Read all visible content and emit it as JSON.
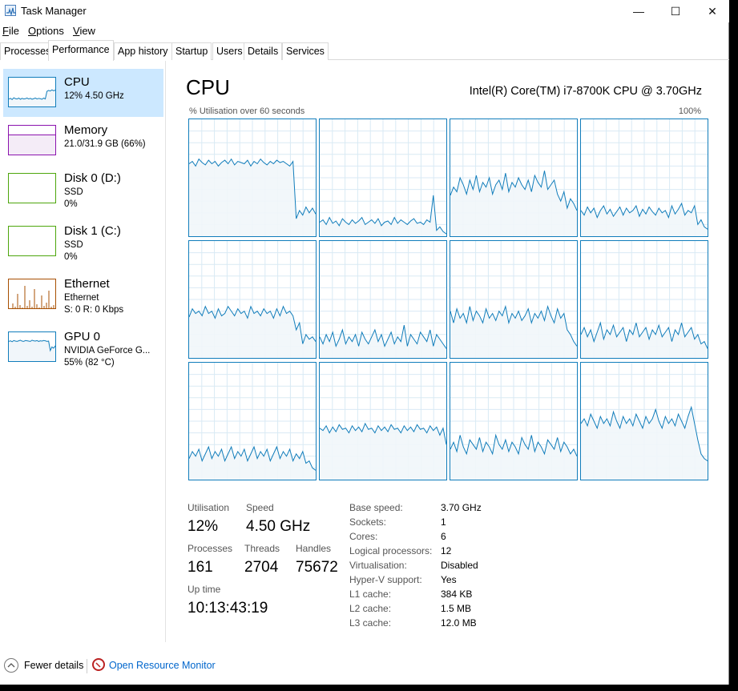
{
  "window": {
    "title": "Task Manager",
    "controls": {
      "minimize": "—",
      "maximize": "☐",
      "close": "✕"
    }
  },
  "menu": [
    {
      "label": "File",
      "accel": "F",
      "rest": "ile"
    },
    {
      "label": "Options",
      "accel": "O",
      "rest": "ptions"
    },
    {
      "label": "View",
      "accel": "V",
      "rest": "iew"
    }
  ],
  "tabs": [
    "Processes",
    "Performance",
    "App history",
    "Startup",
    "Users",
    "Details",
    "Services"
  ],
  "active_tab": "Performance",
  "sidebar": [
    {
      "title": "CPU",
      "lines": [
        "12%  4.50 GHz"
      ],
      "color": "#117dbb",
      "selected": true
    },
    {
      "title": "Memory",
      "lines": [
        "21.0/31.9 GB (66%)"
      ],
      "color": "#8b12ae",
      "selected": false
    },
    {
      "title": "Disk 0 (D:)",
      "lines": [
        "SSD",
        "0%"
      ],
      "color": "#4da60c",
      "selected": false
    },
    {
      "title": "Disk 1 (C:)",
      "lines": [
        "SSD",
        "0%"
      ],
      "color": "#4da60c",
      "selected": false
    },
    {
      "title": "Ethernet",
      "lines": [
        "Ethernet",
        "S: 0  R: 0 Kbps"
      ],
      "color": "#a74f01",
      "selected": false
    },
    {
      "title": "GPU 0",
      "lines": [
        "NVIDIA GeForce G...",
        "55% (82 °C)"
      ],
      "color": "#117dbb",
      "selected": false
    }
  ],
  "main": {
    "title": "CPU",
    "cpu_name": "Intel(R) Core(TM) i7-8700K CPU @ 3.70GHz",
    "graph_label": "% Utilisation over 60 seconds",
    "graph_max": "100%",
    "accent": "#117dbb",
    "fill": "#f1f6fa",
    "grid_color": "#d9eaf4"
  },
  "stats": {
    "utilisation_label": "Utilisation",
    "utilisation": "12%",
    "speed_label": "Speed",
    "speed": "4.50 GHz",
    "processes_label": "Processes",
    "processes": "161",
    "threads_label": "Threads",
    "threads": "2704",
    "handles_label": "Handles",
    "handles": "75672",
    "uptime_label": "Up time",
    "uptime": "10:13:43:19"
  },
  "specs": [
    {
      "label": "Base speed:",
      "value": "3.70 GHz"
    },
    {
      "label": "Sockets:",
      "value": "1"
    },
    {
      "label": "Cores:",
      "value": "6"
    },
    {
      "label": "Logical processors:",
      "value": "12"
    },
    {
      "label": "Virtualisation:",
      "value": "Disabled"
    },
    {
      "label": "Hyper-V support:",
      "value": "Yes"
    },
    {
      "label": "L1 cache:",
      "value": "384 KB"
    },
    {
      "label": "L2 cache:",
      "value": "1.5 MB"
    },
    {
      "label": "L3 cache:",
      "value": "12.0 MB"
    }
  ],
  "footer": {
    "fewer_details": "Fewer details",
    "open_resource_monitor": "Open Resource Monitor"
  },
  "core_utilisation_percent": [
    [
      62,
      64,
      60,
      66,
      63,
      61,
      65,
      62,
      64,
      60,
      63,
      65,
      62,
      66,
      61,
      64,
      63,
      62,
      65,
      60,
      64,
      62,
      66,
      63,
      61,
      64,
      62,
      65,
      63,
      64,
      62,
      60,
      64,
      15,
      22,
      18,
      25,
      20,
      24,
      19
    ],
    [
      12,
      14,
      10,
      16,
      11,
      13,
      9,
      15,
      12,
      10,
      14,
      11,
      13,
      16,
      10,
      12,
      14,
      11,
      15,
      9,
      12,
      13,
      10,
      16,
      11,
      14,
      12,
      10,
      13,
      15,
      11,
      12,
      10,
      14,
      12,
      35,
      5,
      8,
      4,
      2
    ],
    [
      35,
      42,
      38,
      50,
      44,
      36,
      48,
      40,
      52,
      38,
      46,
      42,
      50,
      36,
      44,
      48,
      40,
      54,
      38,
      46,
      42,
      50,
      44,
      40,
      48,
      38,
      52,
      46,
      42,
      56,
      40,
      44,
      48,
      36,
      30,
      38,
      24,
      32,
      28,
      22
    ],
    [
      22,
      18,
      25,
      20,
      24,
      16,
      22,
      26,
      19,
      23,
      17,
      21,
      25,
      18,
      24,
      20,
      22,
      26,
      17,
      23,
      19,
      25,
      21,
      18,
      24,
      20,
      22,
      16,
      26,
      19,
      23,
      28,
      18,
      22,
      20,
      26,
      10,
      14,
      8,
      6
    ],
    [
      35,
      42,
      38,
      40,
      36,
      44,
      38,
      40,
      34,
      42,
      36,
      38,
      44,
      40,
      36,
      42,
      38,
      40,
      34,
      44,
      38,
      40,
      36,
      42,
      38,
      40,
      34,
      42,
      36,
      44,
      38,
      40,
      36,
      24,
      30,
      12,
      20,
      16,
      18,
      14
    ],
    [
      18,
      12,
      20,
      14,
      22,
      10,
      16,
      24,
      12,
      18,
      14,
      20,
      10,
      22,
      16,
      12,
      18,
      24,
      14,
      20,
      10,
      16,
      22,
      12,
      18,
      14,
      28,
      10,
      20,
      16,
      12,
      22,
      18,
      14,
      24,
      10,
      20,
      16,
      12,
      8
    ],
    [
      40,
      30,
      42,
      34,
      38,
      30,
      44,
      32,
      40,
      36,
      30,
      42,
      34,
      38,
      32,
      40,
      36,
      44,
      30,
      38,
      34,
      40,
      32,
      36,
      42,
      30,
      38,
      34,
      40,
      32,
      44,
      36,
      30,
      42,
      34,
      38,
      24,
      20,
      14,
      10
    ],
    [
      20,
      26,
      18,
      24,
      14,
      22,
      30,
      16,
      24,
      20,
      28,
      18,
      22,
      26,
      14,
      24,
      20,
      30,
      18,
      22,
      26,
      16,
      24,
      20,
      28,
      18,
      22,
      26,
      14,
      24,
      20,
      30,
      18,
      22,
      26,
      16,
      20,
      12,
      14,
      8
    ],
    [
      18,
      24,
      20,
      26,
      16,
      22,
      28,
      18,
      24,
      20,
      26,
      16,
      22,
      28,
      18,
      24,
      20,
      26,
      16,
      22,
      28,
      18,
      24,
      20,
      26,
      16,
      22,
      28,
      18,
      24,
      20,
      26,
      16,
      22,
      18,
      24,
      14,
      16,
      10,
      8
    ],
    [
      44,
      42,
      46,
      40,
      45,
      41,
      47,
      43,
      44,
      40,
      46,
      42,
      45,
      41,
      48,
      43,
      44,
      40,
      46,
      42,
      45,
      41,
      47,
      43,
      44,
      40,
      46,
      42,
      45,
      41,
      47,
      43,
      44,
      40,
      46,
      42,
      45,
      38,
      44,
      30
    ],
    [
      26,
      32,
      24,
      38,
      28,
      22,
      34,
      30,
      26,
      36,
      24,
      32,
      28,
      22,
      38,
      30,
      26,
      34,
      24,
      32,
      28,
      22,
      36,
      30,
      26,
      38,
      24,
      32,
      28,
      22,
      34,
      30,
      26,
      36,
      24,
      32,
      28,
      22,
      26,
      20
    ],
    [
      48,
      52,
      46,
      56,
      50,
      44,
      54,
      48,
      52,
      46,
      58,
      50,
      44,
      54,
      48,
      52,
      46,
      56,
      50,
      44,
      54,
      48,
      52,
      60,
      50,
      44,
      54,
      48,
      52,
      46,
      56,
      50,
      44,
      54,
      62,
      48,
      34,
      22,
      18,
      16
    ]
  ],
  "thumb_series": {
    "cpu": [
      30,
      32,
      28,
      34,
      31,
      30,
      33,
      29,
      32,
      30,
      31,
      33,
      30,
      32,
      29,
      31,
      33,
      30,
      32,
      31,
      29,
      33,
      30,
      55,
      58,
      56,
      60,
      57,
      59,
      56
    ],
    "gpu": [
      70,
      72,
      69,
      73,
      71,
      70,
      72,
      74,
      71,
      70,
      73,
      72,
      71,
      70,
      74,
      72,
      71,
      73,
      70,
      72,
      71,
      73,
      72,
      70,
      71,
      40,
      52,
      48,
      55,
      50
    ]
  }
}
